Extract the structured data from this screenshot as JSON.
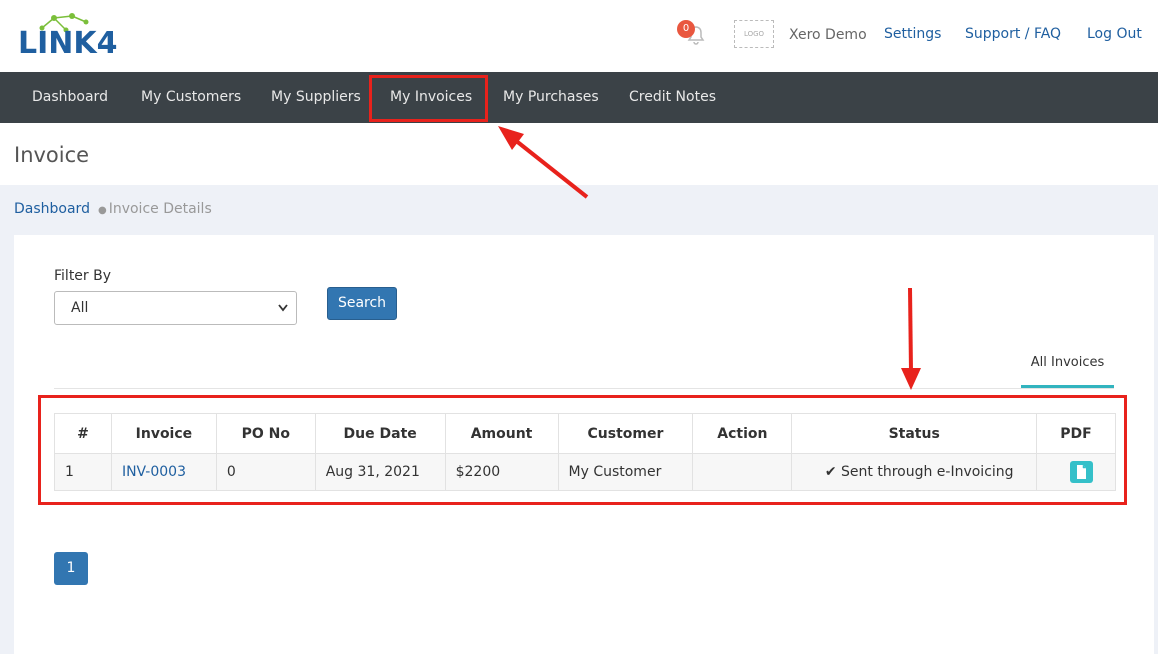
{
  "header": {
    "logo_text": "LINK4",
    "notification_count": "0",
    "company_logo_placeholder": "LOGO",
    "company_name": "Xero Demo",
    "links": [
      {
        "label": "Settings"
      },
      {
        "label": "Support / FAQ"
      },
      {
        "label": "Log Out"
      }
    ]
  },
  "nav": {
    "items": [
      {
        "label": "Dashboard"
      },
      {
        "label": "My Customers"
      },
      {
        "label": "My Suppliers"
      },
      {
        "label": "My Invoices"
      },
      {
        "label": "My Purchases"
      },
      {
        "label": "Credit Notes"
      }
    ],
    "active": "My Invoices"
  },
  "page": {
    "title": "Invoice"
  },
  "breadcrumb": {
    "home": "Dashboard",
    "current": "Invoice Details"
  },
  "filter": {
    "label": "Filter By",
    "selected": "All",
    "search_label": "Search"
  },
  "tabs": {
    "all_invoices": "All Invoices"
  },
  "table": {
    "headers": [
      "#",
      "Invoice",
      "PO No",
      "Due Date",
      "Amount",
      "Customer",
      "Action",
      "Status",
      "PDF"
    ],
    "rows": [
      {
        "num": "1",
        "invoice": "INV-0003",
        "po_no": "0",
        "due_date": "Aug 31, 2021",
        "amount": "$2200",
        "customer": "My Customer",
        "action": "",
        "status": "Sent through e-Invoicing"
      }
    ]
  },
  "pagination": {
    "current_page": "1"
  },
  "colors": {
    "nav_bg": "#3b4247",
    "primary": "#3276b1",
    "link": "#1f5fa0",
    "highlight": "#e8221c",
    "tab_accent": "#32b4bf"
  }
}
